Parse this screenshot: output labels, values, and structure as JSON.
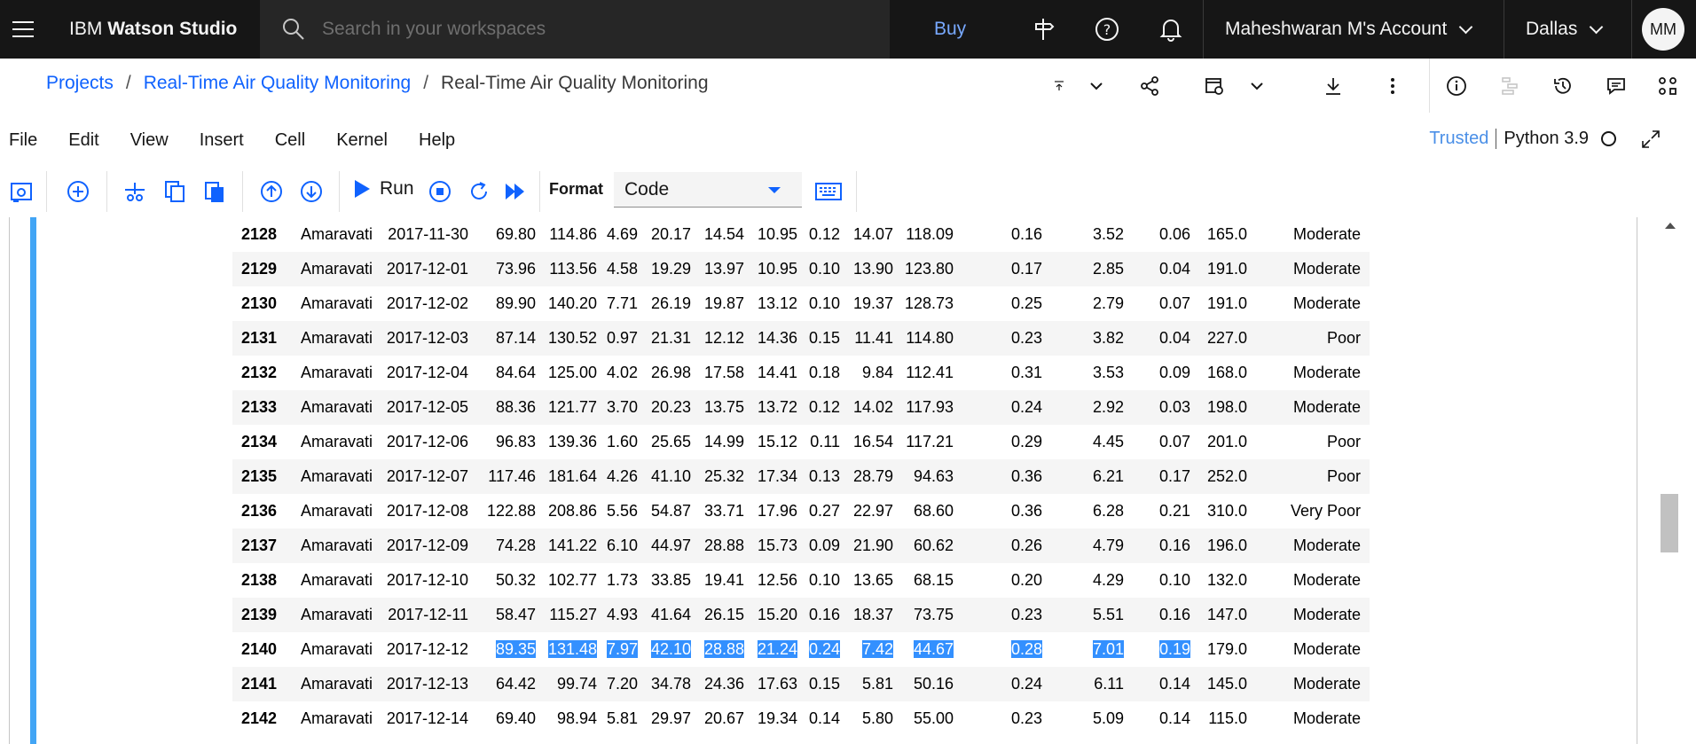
{
  "header": {
    "product_prefix": "IBM",
    "product_name": "Watson Studio",
    "search_placeholder": "Search in your workspaces",
    "buy_label": "Buy",
    "account_label": "Maheshwaran M's Account",
    "region_label": "Dallas",
    "avatar_initials": "MM"
  },
  "breadcrumb": {
    "items": [
      "Projects",
      "Real-Time Air Quality Monitoring"
    ],
    "current": "Real-Time Air Quality Monitoring"
  },
  "menu": [
    "File",
    "Edit",
    "View",
    "Insert",
    "Cell",
    "Kernel",
    "Help"
  ],
  "kernel_status": {
    "trusted": "Trusted",
    "kernel": "Python 3.9"
  },
  "toolbar": {
    "run_label": "Run",
    "format_label": "Format",
    "format_value": "Code"
  },
  "table": {
    "rows": [
      [
        "2128",
        "Amaravati",
        "2017-11-30",
        "69.80",
        "114.86",
        "4.69",
        "20.17",
        "14.54",
        "10.95",
        "0.12",
        "14.07",
        "118.09",
        "0.16",
        "3.52",
        "0.06",
        "165.0",
        "Moderate"
      ],
      [
        "2129",
        "Amaravati",
        "2017-12-01",
        "73.96",
        "113.56",
        "4.58",
        "19.29",
        "13.97",
        "10.95",
        "0.10",
        "13.90",
        "123.80",
        "0.17",
        "2.85",
        "0.04",
        "191.0",
        "Moderate"
      ],
      [
        "2130",
        "Amaravati",
        "2017-12-02",
        "89.90",
        "140.20",
        "7.71",
        "26.19",
        "19.87",
        "13.12",
        "0.10",
        "19.37",
        "128.73",
        "0.25",
        "2.79",
        "0.07",
        "191.0",
        "Moderate"
      ],
      [
        "2131",
        "Amaravati",
        "2017-12-03",
        "87.14",
        "130.52",
        "0.97",
        "21.31",
        "12.12",
        "14.36",
        "0.15",
        "11.41",
        "114.80",
        "0.23",
        "3.82",
        "0.04",
        "227.0",
        "Poor"
      ],
      [
        "2132",
        "Amaravati",
        "2017-12-04",
        "84.64",
        "125.00",
        "4.02",
        "26.98",
        "17.58",
        "14.41",
        "0.18",
        "9.84",
        "112.41",
        "0.31",
        "3.53",
        "0.09",
        "168.0",
        "Moderate"
      ],
      [
        "2133",
        "Amaravati",
        "2017-12-05",
        "88.36",
        "121.77",
        "3.70",
        "20.23",
        "13.75",
        "13.72",
        "0.12",
        "14.02",
        "117.93",
        "0.24",
        "2.92",
        "0.03",
        "198.0",
        "Moderate"
      ],
      [
        "2134",
        "Amaravati",
        "2017-12-06",
        "96.83",
        "139.36",
        "1.60",
        "25.65",
        "14.99",
        "15.12",
        "0.11",
        "16.54",
        "117.21",
        "0.29",
        "4.45",
        "0.07",
        "201.0",
        "Poor"
      ],
      [
        "2135",
        "Amaravati",
        "2017-12-07",
        "117.46",
        "181.64",
        "4.26",
        "41.10",
        "25.32",
        "17.34",
        "0.13",
        "28.79",
        "94.63",
        "0.36",
        "6.21",
        "0.17",
        "252.0",
        "Poor"
      ],
      [
        "2136",
        "Amaravati",
        "2017-12-08",
        "122.88",
        "208.86",
        "5.56",
        "54.87",
        "33.71",
        "17.96",
        "0.27",
        "22.97",
        "68.60",
        "0.36",
        "6.28",
        "0.21",
        "310.0",
        "Very Poor"
      ],
      [
        "2137",
        "Amaravati",
        "2017-12-09",
        "74.28",
        "141.22",
        "6.10",
        "44.97",
        "28.88",
        "15.73",
        "0.09",
        "21.90",
        "60.62",
        "0.26",
        "4.79",
        "0.16",
        "196.0",
        "Moderate"
      ],
      [
        "2138",
        "Amaravati",
        "2017-12-10",
        "50.32",
        "102.77",
        "1.73",
        "33.85",
        "19.41",
        "12.56",
        "0.10",
        "13.65",
        "68.15",
        "0.20",
        "4.29",
        "0.10",
        "132.0",
        "Moderate"
      ],
      [
        "2139",
        "Amaravati",
        "2017-12-11",
        "58.47",
        "115.27",
        "4.93",
        "41.64",
        "26.15",
        "15.20",
        "0.16",
        "18.37",
        "73.75",
        "0.23",
        "5.51",
        "0.16",
        "147.0",
        "Moderate"
      ],
      [
        "2140",
        "Amaravati",
        "2017-12-12",
        "89.35",
        "131.48",
        "7.97",
        "42.10",
        "28.88",
        "21.24",
        "0.24",
        "7.42",
        "44.67",
        "0.28",
        "7.01",
        "0.19",
        "179.0",
        "Moderate"
      ],
      [
        "2141",
        "Amaravati",
        "2017-12-13",
        "64.42",
        "99.74",
        "7.20",
        "34.78",
        "24.36",
        "17.63",
        "0.15",
        "5.81",
        "50.16",
        "0.24",
        "6.11",
        "0.14",
        "145.0",
        "Moderate"
      ],
      [
        "2142",
        "Amaravati",
        "2017-12-14",
        "69.40",
        "98.94",
        "5.81",
        "29.97",
        "20.67",
        "19.34",
        "0.14",
        "5.80",
        "55.00",
        "0.23",
        "5.09",
        "0.14",
        "115.0",
        "Moderate"
      ]
    ],
    "highlighted_row": "2140",
    "highlight_color": "#3390ff"
  },
  "colors": {
    "accent": "#0f62fe",
    "cell_bar": "#42a5f5",
    "header_bg": "#161616"
  }
}
